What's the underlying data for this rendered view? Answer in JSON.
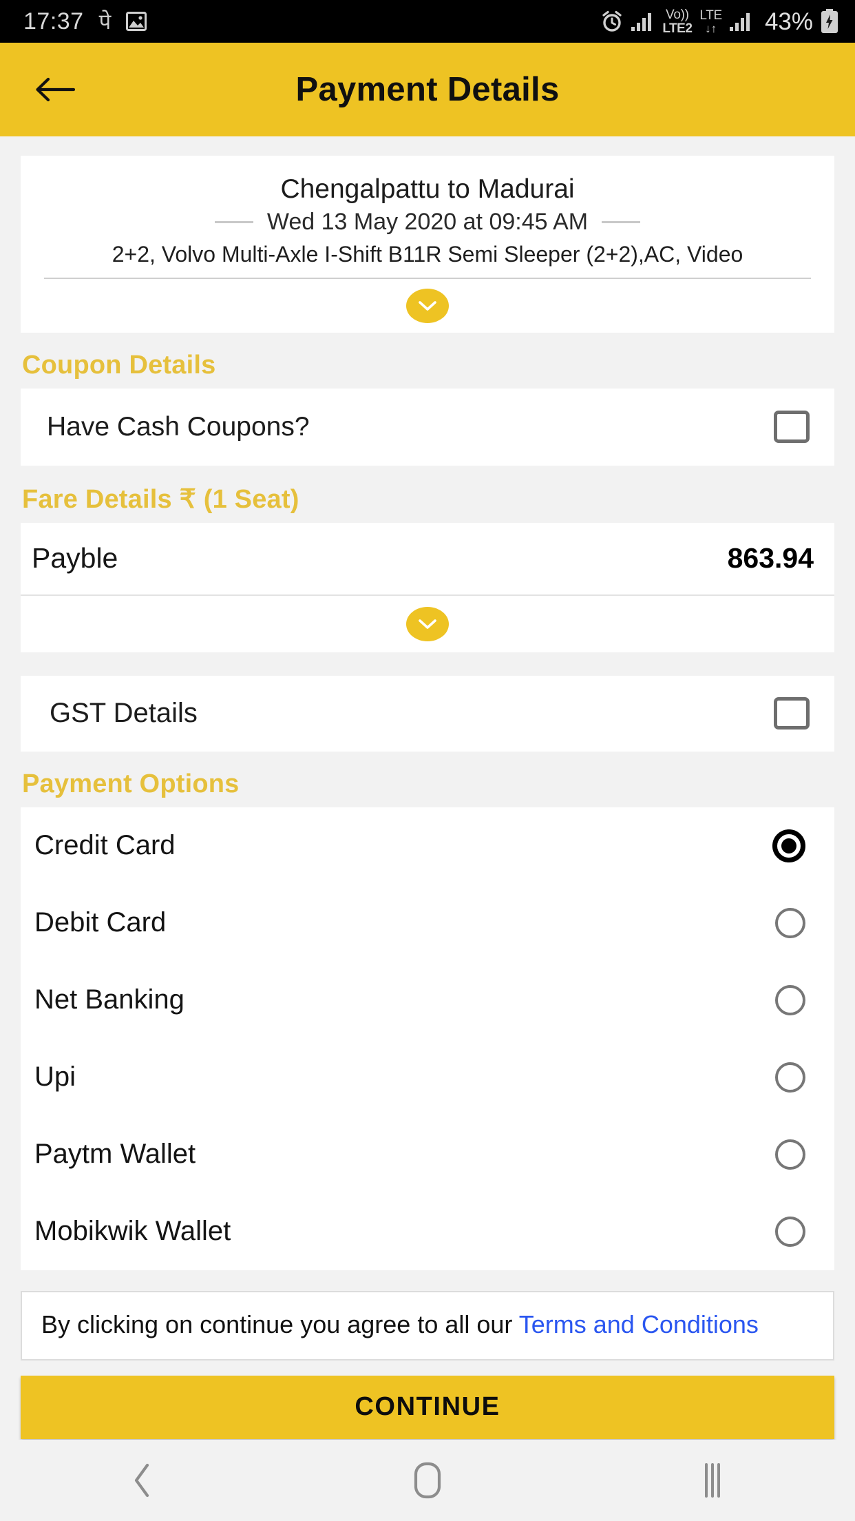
{
  "status_bar": {
    "time": "17:37",
    "payment_glyph": "पे",
    "gallery_icon": "image-icon",
    "alarm_icon": "alarm-icon",
    "sim1_label_top": "Vo))",
    "sim1_label_bottom": "LTE2",
    "sim2_label_top": "LTE",
    "sim2_arrows": "↓↑",
    "battery_percent": "43%",
    "battery_icon": "battery-charging-icon"
  },
  "header": {
    "title": "Payment Details",
    "back_icon": "arrow-left-icon",
    "background_color": "#eec323"
  },
  "journey": {
    "route": "Chengalpattu to Madurai",
    "datetime": "Wed 13 May 2020 at 09:45 AM",
    "bus_details": "2+2, Volvo Multi-Axle I-Shift B11R Semi Sleeper (2+2),AC, Video",
    "expand_icon": "chevron-down-icon"
  },
  "coupon": {
    "section_title": "Coupon Details",
    "label": "Have Cash Coupons?",
    "checked": false
  },
  "fare": {
    "section_title": "Fare Details ₹ (1 Seat)",
    "label": "Payble",
    "amount": "863.94",
    "expand_icon": "chevron-down-icon"
  },
  "gst": {
    "label": "GST Details",
    "checked": false
  },
  "payment_options": {
    "section_title": "Payment Options",
    "selected": "Credit Card",
    "items": [
      {
        "label": "Credit Card",
        "selected": true
      },
      {
        "label": "Debit Card",
        "selected": false
      },
      {
        "label": "Net Banking",
        "selected": false
      },
      {
        "label": "Upi",
        "selected": false
      },
      {
        "label": "Paytm Wallet",
        "selected": false
      },
      {
        "label": "Mobikwik Wallet",
        "selected": false
      }
    ]
  },
  "terms": {
    "prefix": "By clicking on continue you agree to all our ",
    "link_text": "Terms and Conditions",
    "link_color": "#2a56f0"
  },
  "continue": {
    "label": "CONTINUE"
  },
  "nav_bar": {
    "back_icon": "nav-back-icon",
    "home_icon": "nav-home-icon",
    "recents_icon": "nav-recents-icon"
  },
  "theme": {
    "accent_yellow": "#eec323",
    "section_title_yellow": "#e6c03c",
    "page_background": "#f2f2f2",
    "card_background": "#ffffff"
  }
}
